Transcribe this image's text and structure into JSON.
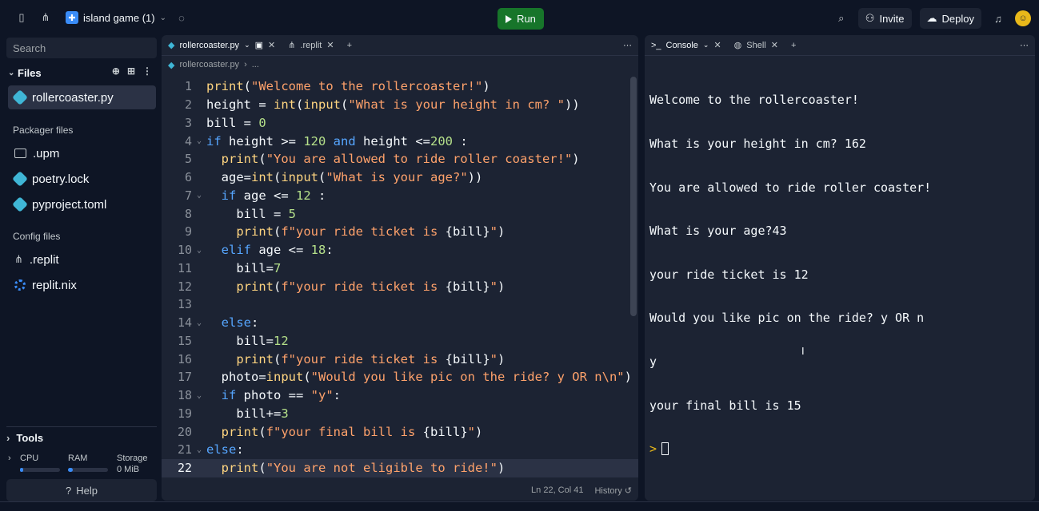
{
  "topbar": {
    "repl_name": "island game (1)",
    "run_label": "Run",
    "invite_label": "Invite",
    "deploy_label": "Deploy"
  },
  "sidebar": {
    "search_placeholder": "Search",
    "files_title": "Files",
    "active_file": "rollercoaster.py",
    "packager_title": "Packager files",
    "packager_items": [
      ".upm",
      "poetry.lock",
      "pyproject.toml"
    ],
    "config_title": "Config files",
    "config_items": [
      ".replit",
      "replit.nix"
    ],
    "tools_label": "Tools",
    "resources": {
      "cpu_label": "CPU",
      "ram_label": "RAM",
      "storage_label": "Storage",
      "storage_value": "0 MiB",
      "cpu_usage": 0.08,
      "ram_usage": 0.12
    },
    "help_label": "Help"
  },
  "editor": {
    "tabs": [
      "rollercoaster.py",
      ".replit"
    ],
    "breadcrumb": [
      "rollercoaster.py",
      "..."
    ],
    "status_pos": "Ln 22, Col 41",
    "history_label": "History",
    "current_line": 22
  },
  "console": {
    "tabs": [
      "Console",
      "Shell"
    ],
    "output": [
      "Welcome to the rollercoaster!",
      "What is your height in cm? 162",
      "You are allowed to ride roller coaster!",
      "What is your age?43",
      "your ride ticket is 12",
      "Would you like pic on the ride? y OR n",
      "y",
      "your final bill is 15"
    ],
    "prompt": ">"
  }
}
